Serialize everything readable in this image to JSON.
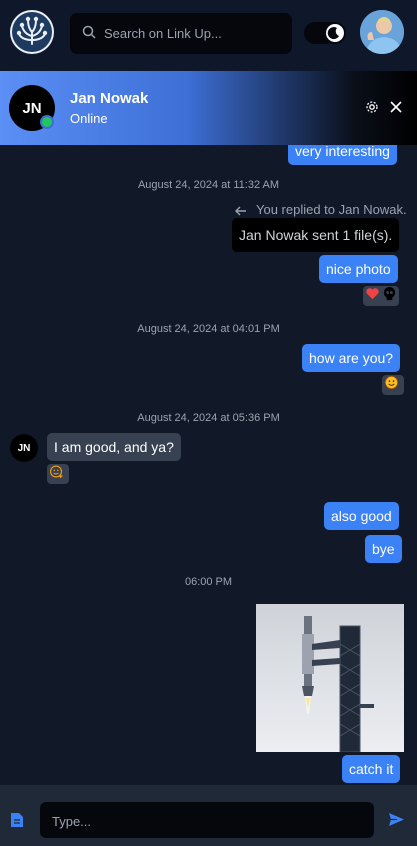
{
  "topbar": {
    "search_placeholder": "Search on Link Up...",
    "logo_icon": "link-up-logo-icon",
    "theme_icon": "moon-icon"
  },
  "chat_header": {
    "initials": "JN",
    "name": "Jan Nowak",
    "status": "Online"
  },
  "messages": {
    "partial_msg": "very interesting",
    "ts1": "August 24, 2024 at 11:32 AM",
    "reply_note": "You replied to Jan Nowak.",
    "replied_text": "Jan Nowak sent 1 file(s).",
    "msg_nice_photo": "nice photo",
    "ts2": "August 24, 2024 at 04:01 PM",
    "msg_how_are_you": "how are you?",
    "ts3": "August 24, 2024 at 05:36 PM",
    "incoming_initials": "JN",
    "msg_i_am_good": "I am good, and ya?",
    "msg_also_good": "also good",
    "msg_bye": "bye",
    "ts4": "06:00 PM",
    "msg_catch_it": "catch it"
  },
  "composer": {
    "placeholder": "Type..."
  },
  "colors": {
    "accent": "#3b82f6",
    "online": "#22c55e",
    "background": "#111827",
    "incoming_bubble": "#374151"
  }
}
